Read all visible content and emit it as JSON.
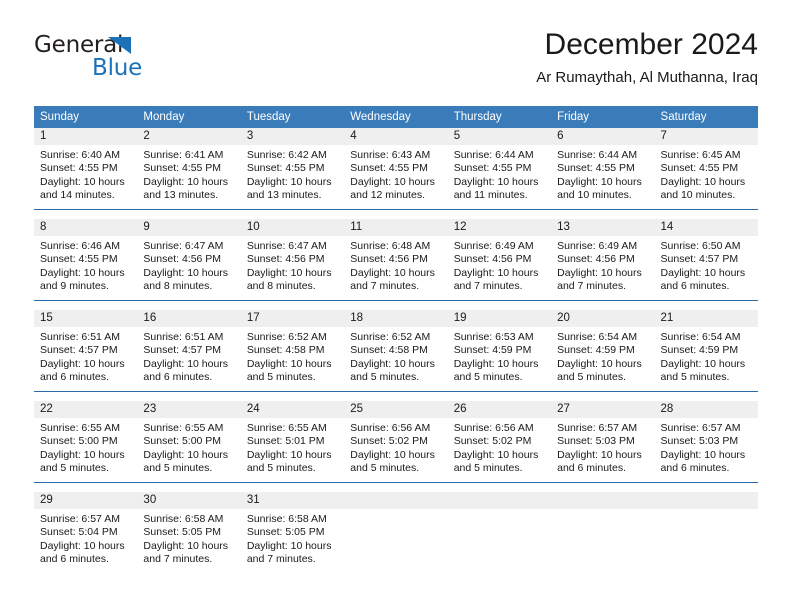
{
  "logo": {
    "word_one": "General",
    "word_two": "Blue",
    "triangle_icon": "triangle-icon",
    "accent_color": "#1b72b8"
  },
  "header": {
    "title": "December 2024",
    "subtitle": "Ar Rumaythah, Al Muthanna, Iraq"
  },
  "calendar": {
    "header_bg": "#3a7cba",
    "daynum_bg": "#efefef",
    "rule_color": "#2a6aa8",
    "weekdays": [
      "Sunday",
      "Monday",
      "Tuesday",
      "Wednesday",
      "Thursday",
      "Friday",
      "Saturday"
    ],
    "weeks": [
      [
        {
          "day": "1",
          "sunrise": "Sunrise: 6:40 AM",
          "sunset": "Sunset: 4:55 PM",
          "daylight_1": "Daylight: 10 hours",
          "daylight_2": "and 14 minutes."
        },
        {
          "day": "2",
          "sunrise": "Sunrise: 6:41 AM",
          "sunset": "Sunset: 4:55 PM",
          "daylight_1": "Daylight: 10 hours",
          "daylight_2": "and 13 minutes."
        },
        {
          "day": "3",
          "sunrise": "Sunrise: 6:42 AM",
          "sunset": "Sunset: 4:55 PM",
          "daylight_1": "Daylight: 10 hours",
          "daylight_2": "and 13 minutes."
        },
        {
          "day": "4",
          "sunrise": "Sunrise: 6:43 AM",
          "sunset": "Sunset: 4:55 PM",
          "daylight_1": "Daylight: 10 hours",
          "daylight_2": "and 12 minutes."
        },
        {
          "day": "5",
          "sunrise": "Sunrise: 6:44 AM",
          "sunset": "Sunset: 4:55 PM",
          "daylight_1": "Daylight: 10 hours",
          "daylight_2": "and 11 minutes."
        },
        {
          "day": "6",
          "sunrise": "Sunrise: 6:44 AM",
          "sunset": "Sunset: 4:55 PM",
          "daylight_1": "Daylight: 10 hours",
          "daylight_2": "and 10 minutes."
        },
        {
          "day": "7",
          "sunrise": "Sunrise: 6:45 AM",
          "sunset": "Sunset: 4:55 PM",
          "daylight_1": "Daylight: 10 hours",
          "daylight_2": "and 10 minutes."
        }
      ],
      [
        {
          "day": "8",
          "sunrise": "Sunrise: 6:46 AM",
          "sunset": "Sunset: 4:55 PM",
          "daylight_1": "Daylight: 10 hours",
          "daylight_2": "and 9 minutes."
        },
        {
          "day": "9",
          "sunrise": "Sunrise: 6:47 AM",
          "sunset": "Sunset: 4:56 PM",
          "daylight_1": "Daylight: 10 hours",
          "daylight_2": "and 8 minutes."
        },
        {
          "day": "10",
          "sunrise": "Sunrise: 6:47 AM",
          "sunset": "Sunset: 4:56 PM",
          "daylight_1": "Daylight: 10 hours",
          "daylight_2": "and 8 minutes."
        },
        {
          "day": "11",
          "sunrise": "Sunrise: 6:48 AM",
          "sunset": "Sunset: 4:56 PM",
          "daylight_1": "Daylight: 10 hours",
          "daylight_2": "and 7 minutes."
        },
        {
          "day": "12",
          "sunrise": "Sunrise: 6:49 AM",
          "sunset": "Sunset: 4:56 PM",
          "daylight_1": "Daylight: 10 hours",
          "daylight_2": "and 7 minutes."
        },
        {
          "day": "13",
          "sunrise": "Sunrise: 6:49 AM",
          "sunset": "Sunset: 4:56 PM",
          "daylight_1": "Daylight: 10 hours",
          "daylight_2": "and 7 minutes."
        },
        {
          "day": "14",
          "sunrise": "Sunrise: 6:50 AM",
          "sunset": "Sunset: 4:57 PM",
          "daylight_1": "Daylight: 10 hours",
          "daylight_2": "and 6 minutes."
        }
      ],
      [
        {
          "day": "15",
          "sunrise": "Sunrise: 6:51 AM",
          "sunset": "Sunset: 4:57 PM",
          "daylight_1": "Daylight: 10 hours",
          "daylight_2": "and 6 minutes."
        },
        {
          "day": "16",
          "sunrise": "Sunrise: 6:51 AM",
          "sunset": "Sunset: 4:57 PM",
          "daylight_1": "Daylight: 10 hours",
          "daylight_2": "and 6 minutes."
        },
        {
          "day": "17",
          "sunrise": "Sunrise: 6:52 AM",
          "sunset": "Sunset: 4:58 PM",
          "daylight_1": "Daylight: 10 hours",
          "daylight_2": "and 5 minutes."
        },
        {
          "day": "18",
          "sunrise": "Sunrise: 6:52 AM",
          "sunset": "Sunset: 4:58 PM",
          "daylight_1": "Daylight: 10 hours",
          "daylight_2": "and 5 minutes."
        },
        {
          "day": "19",
          "sunrise": "Sunrise: 6:53 AM",
          "sunset": "Sunset: 4:59 PM",
          "daylight_1": "Daylight: 10 hours",
          "daylight_2": "and 5 minutes."
        },
        {
          "day": "20",
          "sunrise": "Sunrise: 6:54 AM",
          "sunset": "Sunset: 4:59 PM",
          "daylight_1": "Daylight: 10 hours",
          "daylight_2": "and 5 minutes."
        },
        {
          "day": "21",
          "sunrise": "Sunrise: 6:54 AM",
          "sunset": "Sunset: 4:59 PM",
          "daylight_1": "Daylight: 10 hours",
          "daylight_2": "and 5 minutes."
        }
      ],
      [
        {
          "day": "22",
          "sunrise": "Sunrise: 6:55 AM",
          "sunset": "Sunset: 5:00 PM",
          "daylight_1": "Daylight: 10 hours",
          "daylight_2": "and 5 minutes."
        },
        {
          "day": "23",
          "sunrise": "Sunrise: 6:55 AM",
          "sunset": "Sunset: 5:00 PM",
          "daylight_1": "Daylight: 10 hours",
          "daylight_2": "and 5 minutes."
        },
        {
          "day": "24",
          "sunrise": "Sunrise: 6:55 AM",
          "sunset": "Sunset: 5:01 PM",
          "daylight_1": "Daylight: 10 hours",
          "daylight_2": "and 5 minutes."
        },
        {
          "day": "25",
          "sunrise": "Sunrise: 6:56 AM",
          "sunset": "Sunset: 5:02 PM",
          "daylight_1": "Daylight: 10 hours",
          "daylight_2": "and 5 minutes."
        },
        {
          "day": "26",
          "sunrise": "Sunrise: 6:56 AM",
          "sunset": "Sunset: 5:02 PM",
          "daylight_1": "Daylight: 10 hours",
          "daylight_2": "and 5 minutes."
        },
        {
          "day": "27",
          "sunrise": "Sunrise: 6:57 AM",
          "sunset": "Sunset: 5:03 PM",
          "daylight_1": "Daylight: 10 hours",
          "daylight_2": "and 6 minutes."
        },
        {
          "day": "28",
          "sunrise": "Sunrise: 6:57 AM",
          "sunset": "Sunset: 5:03 PM",
          "daylight_1": "Daylight: 10 hours",
          "daylight_2": "and 6 minutes."
        }
      ],
      [
        {
          "day": "29",
          "sunrise": "Sunrise: 6:57 AM",
          "sunset": "Sunset: 5:04 PM",
          "daylight_1": "Daylight: 10 hours",
          "daylight_2": "and 6 minutes."
        },
        {
          "day": "30",
          "sunrise": "Sunrise: 6:58 AM",
          "sunset": "Sunset: 5:05 PM",
          "daylight_1": "Daylight: 10 hours",
          "daylight_2": "and 7 minutes."
        },
        {
          "day": "31",
          "sunrise": "Sunrise: 6:58 AM",
          "sunset": "Sunset: 5:05 PM",
          "daylight_1": "Daylight: 10 hours",
          "daylight_2": "and 7 minutes."
        },
        {
          "day": "",
          "sunrise": "",
          "sunset": "",
          "daylight_1": "",
          "daylight_2": ""
        },
        {
          "day": "",
          "sunrise": "",
          "sunset": "",
          "daylight_1": "",
          "daylight_2": ""
        },
        {
          "day": "",
          "sunrise": "",
          "sunset": "",
          "daylight_1": "",
          "daylight_2": ""
        },
        {
          "day": "",
          "sunrise": "",
          "sunset": "",
          "daylight_1": "",
          "daylight_2": ""
        }
      ]
    ]
  }
}
